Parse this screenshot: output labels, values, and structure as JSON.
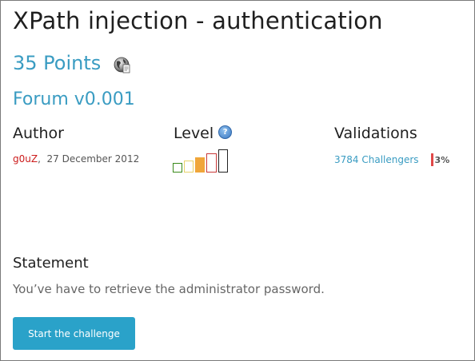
{
  "challenge": {
    "title": "XPath injection - authentication",
    "points": "35 Points",
    "category_icon": "globe-web-icon",
    "subtitle": "Forum v0.001"
  },
  "author": {
    "heading": "Author",
    "name": "g0uZ",
    "separator": ",",
    "date": "27 December 2012"
  },
  "level": {
    "heading": "Level",
    "help_icon": "question-help-icon",
    "difficulty": 3,
    "max": 5
  },
  "validations": {
    "heading": "Validations",
    "challengers": "3784 Challengers",
    "percent": "3%",
    "percent_value": 3,
    "bar_color": "#e04848"
  },
  "statement": {
    "heading": "Statement",
    "text": "You’ve have to retrieve the administrator password."
  },
  "actions": {
    "start_label": "Start the challenge"
  },
  "colors": {
    "accent": "#3a9cc2",
    "button": "#2aa2c9",
    "author_name": "#cc1b1b"
  }
}
